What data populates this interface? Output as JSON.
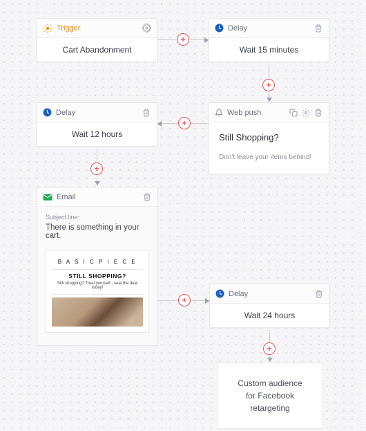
{
  "nodes": {
    "trigger": {
      "type_label": "Trigger",
      "title": "Cart Abandonment"
    },
    "delay1": {
      "type_label": "Delay",
      "title": "Wait 15 minutes"
    },
    "delay2": {
      "type_label": "Delay",
      "title": "Wait 12 hours"
    },
    "webpush": {
      "type_label": "Web push",
      "title": "Still Shopping?",
      "body": "Don't leave your items behind!"
    },
    "email": {
      "type_label": "Email",
      "subject_label": "Subject line:",
      "subject": "There is something in your cart.",
      "preview_brand": "B A S I C  P I E C E",
      "preview_heading": "STILL SHOPPING?",
      "preview_tagline": "Still shopping? Treat yourself - seal the deal today!"
    },
    "delay3": {
      "type_label": "Delay",
      "title": "Wait 24 hours"
    },
    "final": {
      "line1": "Custom audience",
      "line2": "for Facebook retargeting"
    }
  },
  "icons": {
    "trigger": "sun-icon",
    "delay": "clock-icon",
    "webpush": "bell-icon",
    "email": "mail-icon",
    "gear": "gear-icon",
    "trash": "trash-icon",
    "copy": "copy-icon",
    "plus": "plus-icon"
  },
  "colors": {
    "accent_red": "#e15858",
    "delay_icon": "#1f5fbf",
    "trigger_icon": "#f39c12",
    "email_icon": "#1fab55",
    "line": "#c9ccd4"
  }
}
